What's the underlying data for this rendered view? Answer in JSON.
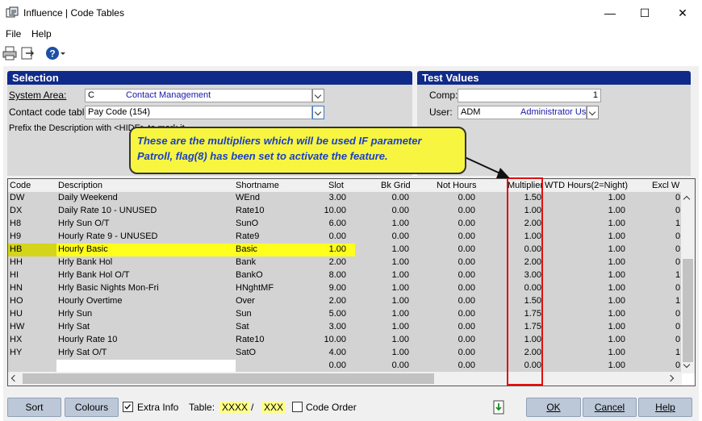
{
  "window": {
    "title": "Influence | Code Tables",
    "minimize": "—",
    "maximize": "☐",
    "close": "✕"
  },
  "menu": {
    "file": "File",
    "help": "Help"
  },
  "selection": {
    "header": "Selection",
    "system_area_label": "System Area:",
    "system_area_code": "C",
    "system_area_name": "Contact Management",
    "contact_code_label": "Contact code table",
    "contact_code_value": "Pay Code  (154)",
    "prefix_label": "Prefix the Description with <HIDE> to mark it"
  },
  "test_values": {
    "header": "Test Values",
    "comp_label": "Comp:",
    "comp_value": "1",
    "user_label": "User:",
    "user_code": "ADM",
    "user_name": "Administrator User"
  },
  "callout": {
    "line1": "These are the multipliers which will be used IF parameter",
    "line2": "Patroll, flag(8) has been set to activate the feature."
  },
  "grid": {
    "headers": [
      "Code",
      "Description",
      "Shortname",
      "Slot",
      "Bk Grid",
      "Not Hours",
      "Multiplier",
      "WTD Hours(2=Night)",
      "Excl W"
    ],
    "rows": [
      [
        "DW",
        "Daily Weekend",
        "WEnd",
        "3.00",
        "0.00",
        "0.00",
        "1.50",
        "1.00",
        "0"
      ],
      [
        "DX",
        "Daily Rate 10 - UNUSED",
        "Rate10",
        "10.00",
        "0.00",
        "0.00",
        "1.00",
        "1.00",
        "0"
      ],
      [
        "H8",
        "Hrly Sun O/T",
        "SunO",
        "6.00",
        "1.00",
        "0.00",
        "2.00",
        "1.00",
        "1"
      ],
      [
        "H9",
        "Hourly Rate 9 - UNUSED",
        "Rate9",
        "0.00",
        "0.00",
        "0.00",
        "1.00",
        "1.00",
        "0"
      ],
      [
        "HB",
        "Hourly Basic",
        "Basic",
        "1.00",
        "1.00",
        "0.00",
        "0.00",
        "1.00",
        "0"
      ],
      [
        "HH",
        "Hrly Bank Hol",
        "Bank",
        "2.00",
        "1.00",
        "0.00",
        "2.00",
        "1.00",
        "0"
      ],
      [
        "HI",
        "Hrly Bank Hol O/T",
        "BankO",
        "8.00",
        "1.00",
        "0.00",
        "3.00",
        "1.00",
        "1"
      ],
      [
        "HN",
        "Hrly Basic Nights Mon-Fri",
        "HNghtMF",
        "9.00",
        "1.00",
        "0.00",
        "0.00",
        "1.00",
        "0"
      ],
      [
        "HO",
        "Hourly Overtime",
        "Over",
        "2.00",
        "1.00",
        "0.00",
        "1.50",
        "1.00",
        "1"
      ],
      [
        "HU",
        "Hrly Sun",
        "Sun",
        "5.00",
        "1.00",
        "0.00",
        "1.75",
        "1.00",
        "0"
      ],
      [
        "HW",
        "Hrly Sat",
        "Sat",
        "3.00",
        "1.00",
        "0.00",
        "1.75",
        "1.00",
        "0"
      ],
      [
        "HX",
        "Hourly Rate 10",
        "Rate10",
        "10.00",
        "1.00",
        "0.00",
        "1.00",
        "1.00",
        "0"
      ],
      [
        "HY",
        "Hrly Sat O/T",
        "SatO",
        "4.00",
        "1.00",
        "0.00",
        "2.00",
        "1.00",
        "1"
      ],
      [
        "",
        "",
        "",
        "0.00",
        "0.00",
        "0.00",
        "0.00",
        "1.00",
        "0"
      ]
    ]
  },
  "footer": {
    "sort": "Sort",
    "colours": "Colours",
    "extra_info": "Extra Info",
    "table_label": "Table:",
    "table_a": "XXXX",
    "slash": "/",
    "table_b": "XXX",
    "code_order": "Code Order",
    "ok": "OK",
    "cancel": "Cancel",
    "help": "Help"
  },
  "colors": {
    "header_blue": "#102a8a",
    "highlight": "#ffff1e",
    "callout": "#f7f540",
    "red": "#e01010"
  }
}
